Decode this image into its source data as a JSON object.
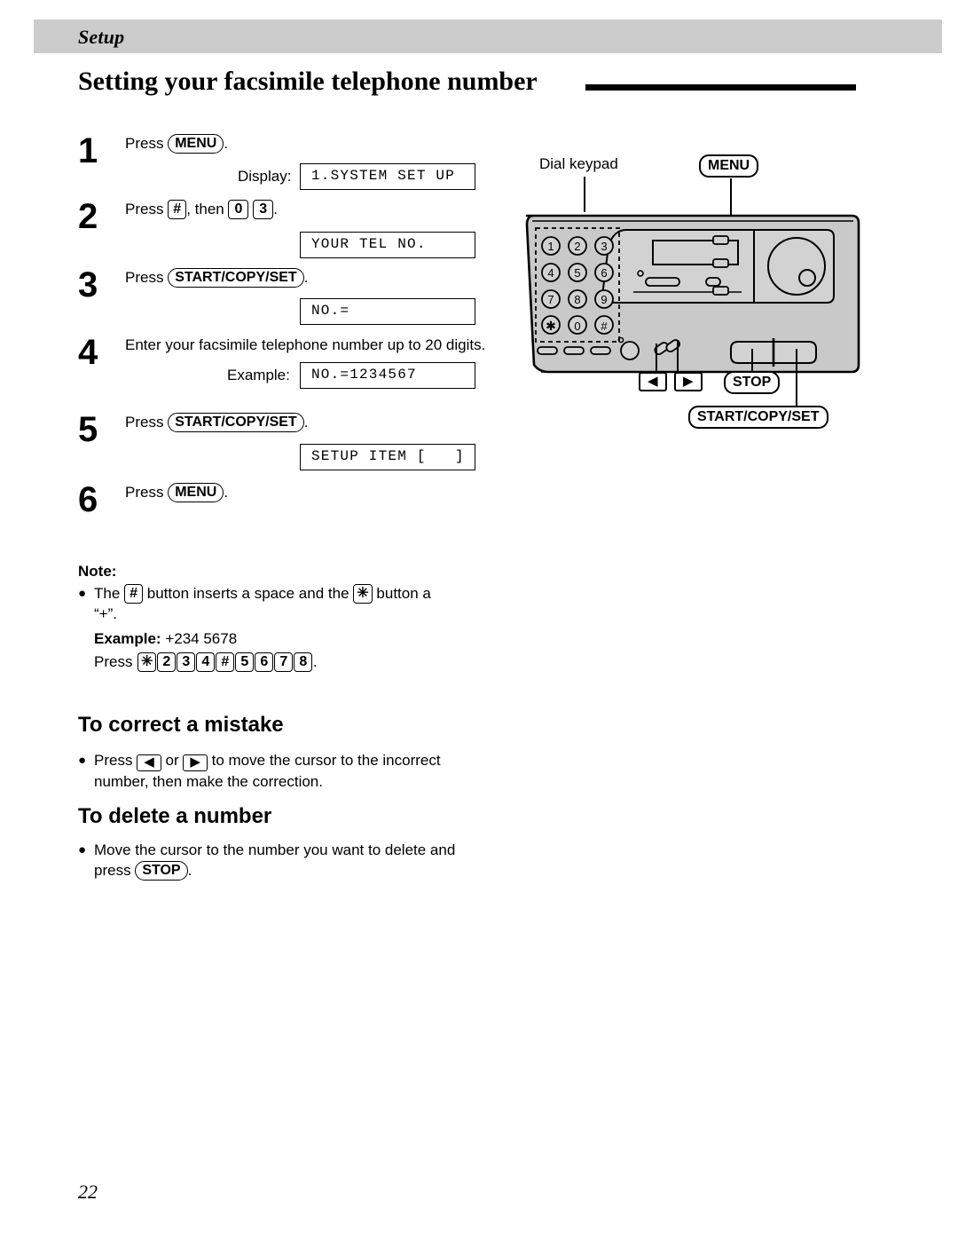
{
  "running_head": "Setup",
  "page_title": "Setting your facsimile telephone number",
  "page_number": "22",
  "steps": [
    {
      "num": "1",
      "press_label": "Press",
      "button": "MENU",
      "period": ".",
      "display_label": "Display:",
      "display_text": "1.SYSTEM SET UP"
    },
    {
      "num": "2",
      "press_label": "Press",
      "key1": "#",
      "then_label": ", then",
      "key2": "0",
      "key3": "3",
      "period": ".",
      "display_label": "",
      "display_text": "YOUR TEL NO."
    },
    {
      "num": "3",
      "press_label": "Press",
      "button": "START/COPY/SET",
      "period": ".",
      "display_label": "",
      "display_text": "NO.="
    },
    {
      "num": "4",
      "text": "Enter your facsimile telephone number up to 20 digits.",
      "display_label": "Example:",
      "display_text": "NO.=1234567"
    },
    {
      "num": "5",
      "press_label": "Press",
      "button": "START/COPY/SET",
      "period": ".",
      "display_label": "",
      "display_text": "SETUP ITEM [   ]"
    },
    {
      "num": "6",
      "press_label": "Press",
      "button": "MENU",
      "period": "."
    }
  ],
  "note": {
    "title": "Note:",
    "bullet": "●",
    "line1_a": "The",
    "line1_key": "#",
    "line1_b": "button inserts a space and the",
    "line1_key2": "✳",
    "line1_c": "button a",
    "line2": "“+”.",
    "example_label": "Example:",
    "example_value": "+234  5678",
    "press_label": "Press",
    "key_sequence": [
      "✳",
      "2",
      "3",
      "4",
      "#",
      "5",
      "6",
      "7",
      "8"
    ],
    "press_period": "."
  },
  "section_correct": {
    "heading": "To correct a mistake",
    "bullet": "●",
    "press_label": "Press",
    "left_icon": "◀",
    "or_label": "or",
    "right_icon": "▶",
    "text_after": "to move the cursor to the incorrect number, then make the correction."
  },
  "section_delete": {
    "heading": "To delete a number",
    "bullet": "●",
    "text_before": "Move the cursor to the number you want to delete and press",
    "button": "STOP",
    "period": "."
  },
  "figure": {
    "caption_keypad": "Dial keypad",
    "label_menu": "MENU",
    "label_stop": "STOP",
    "label_start": "START/COPY/SET",
    "label_left_arrow": "◀",
    "label_right_arrow": "▶",
    "keypad_keys": [
      "1",
      "2",
      "3",
      "4",
      "5",
      "6",
      "7",
      "8",
      "9",
      "✳",
      "0",
      "#"
    ]
  },
  "colors": {
    "head_bar": "#cccccc",
    "device_body": "#c9c9c9",
    "device_panel": "#d2d2d2",
    "ink": "#000000"
  }
}
